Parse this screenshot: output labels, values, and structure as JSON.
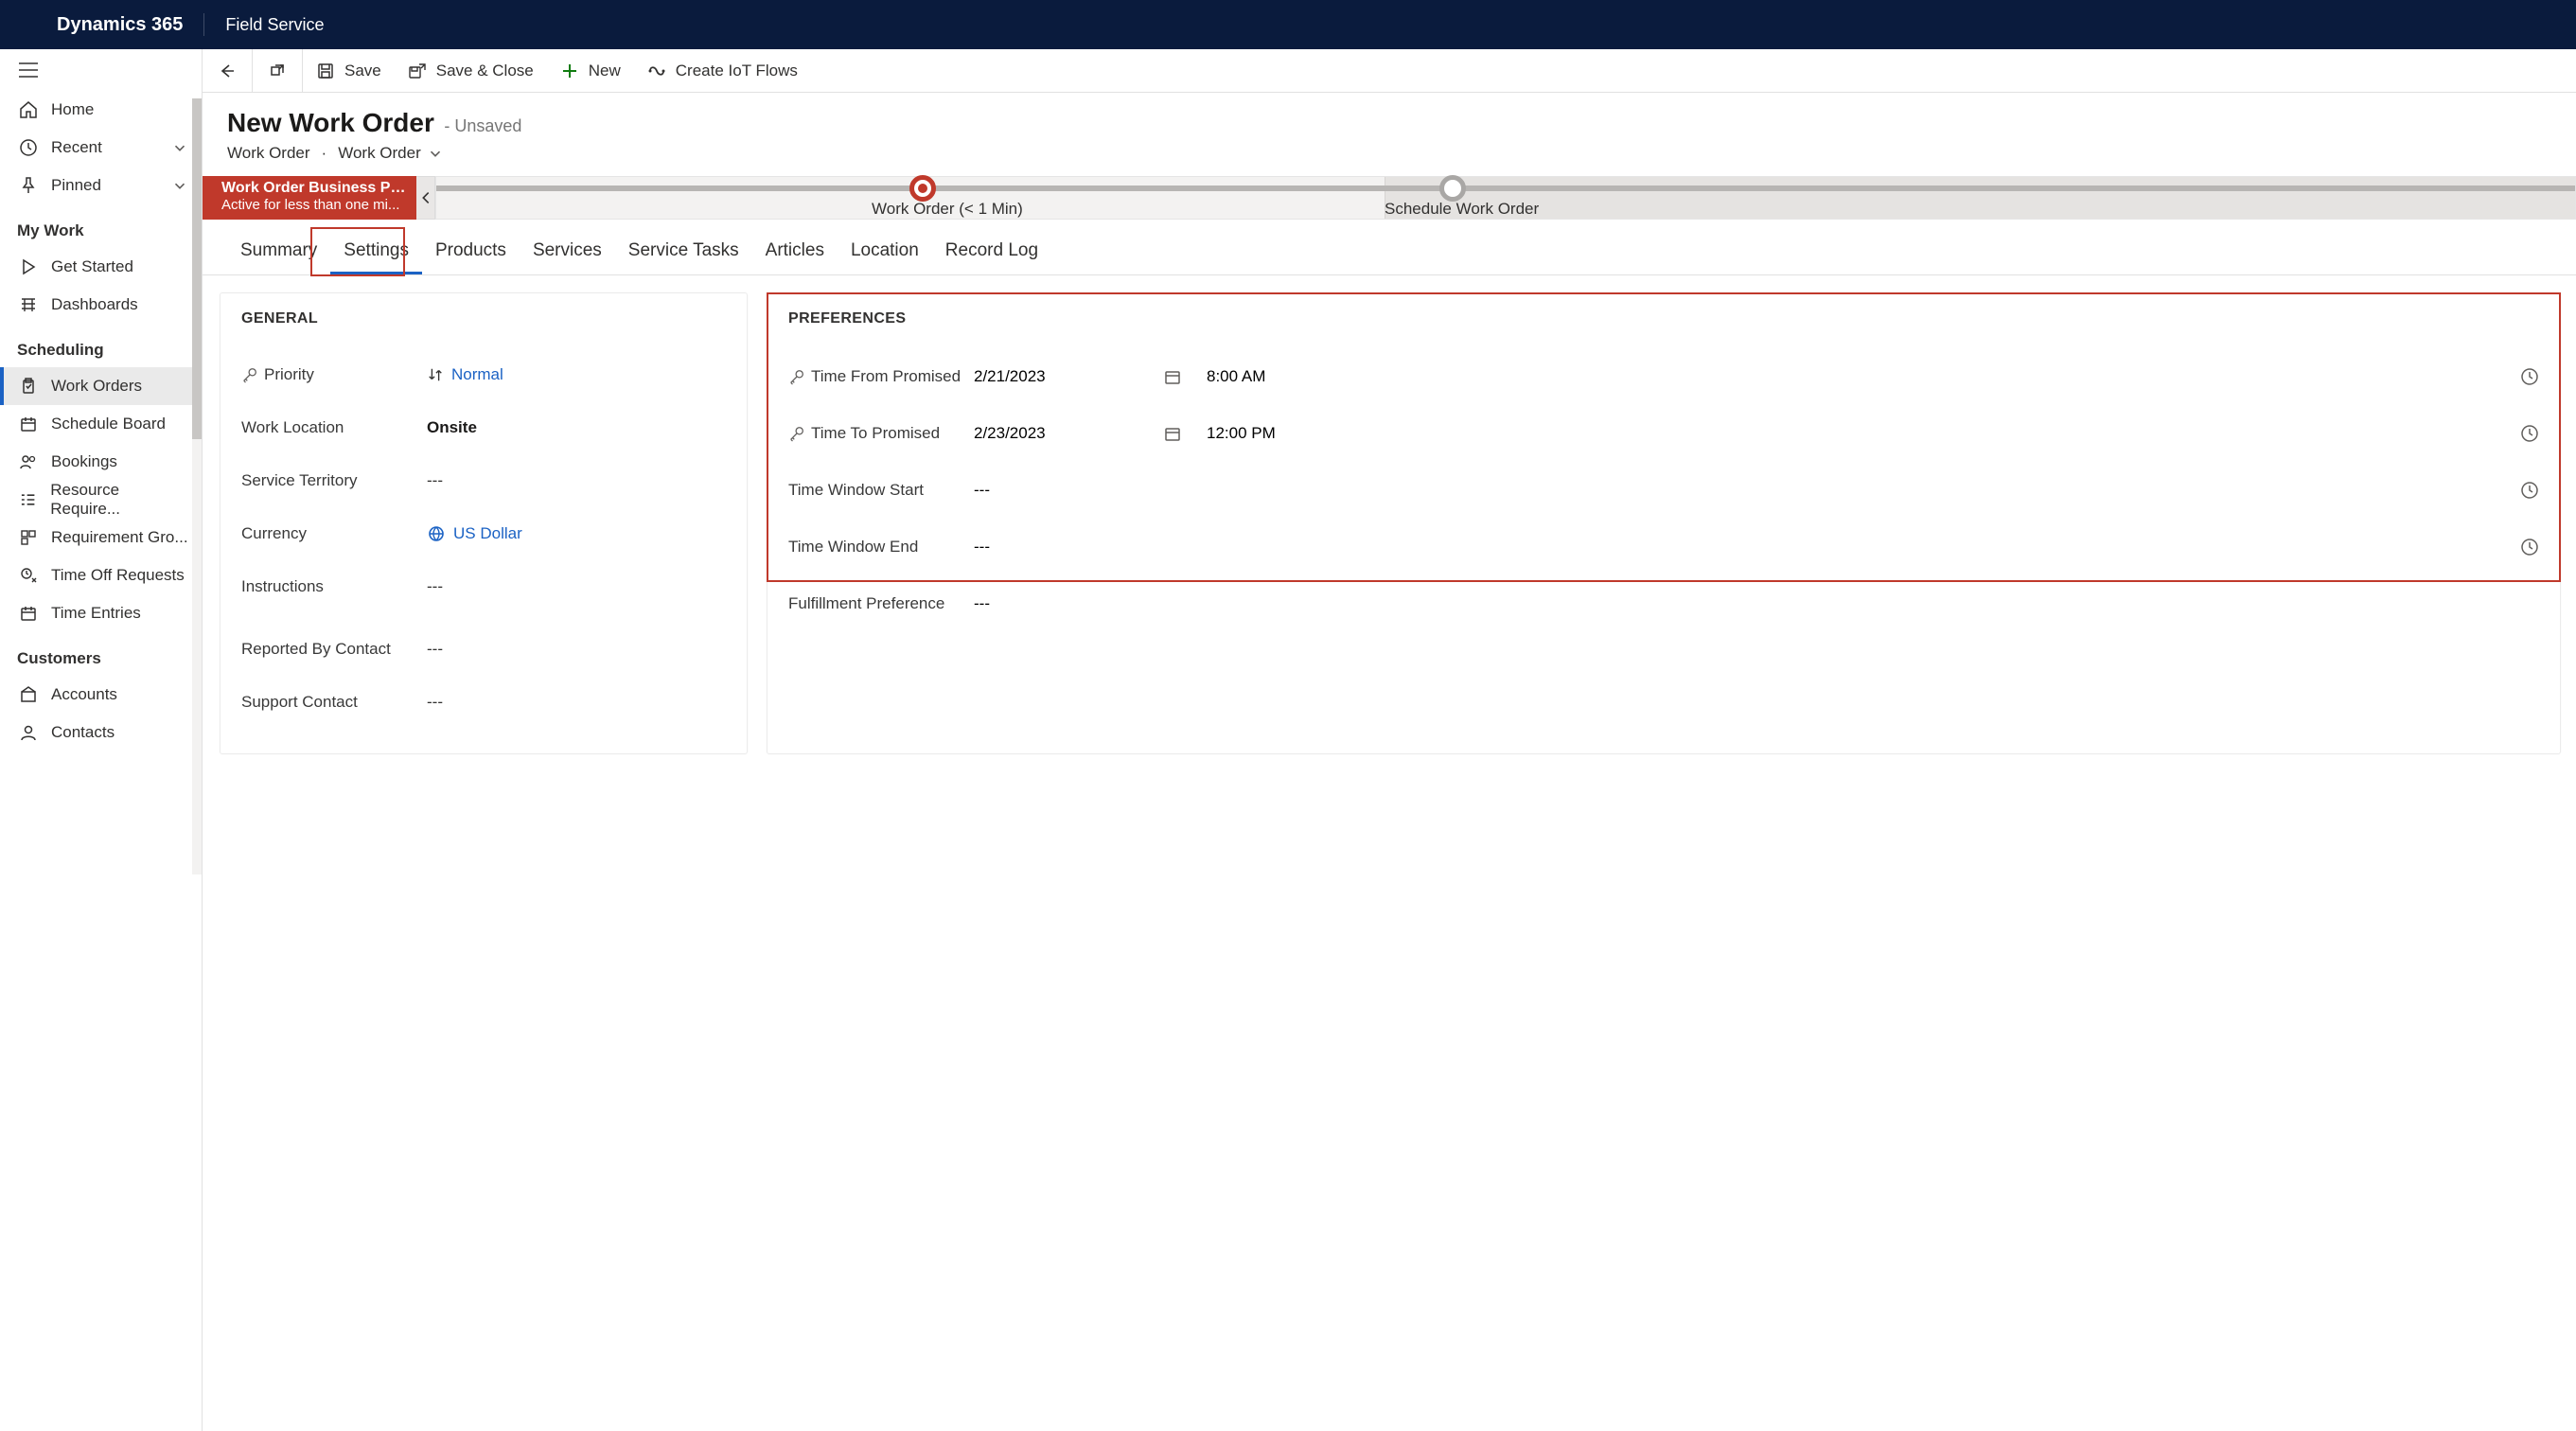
{
  "topbar": {
    "brand": "Dynamics 365",
    "area": "Field Service"
  },
  "sidebar": {
    "home": "Home",
    "recent": "Recent",
    "pinned": "Pinned",
    "sections": {
      "my_work": {
        "title": "My Work",
        "items": [
          "Get Started",
          "Dashboards"
        ]
      },
      "scheduling": {
        "title": "Scheduling",
        "items": [
          "Work Orders",
          "Schedule Board",
          "Bookings",
          "Resource Require...",
          "Requirement Gro...",
          "Time Off Requests",
          "Time Entries"
        ]
      },
      "customers": {
        "title": "Customers",
        "items": [
          "Accounts",
          "Contacts"
        ]
      }
    }
  },
  "toolbar": {
    "save": "Save",
    "save_close": "Save & Close",
    "new": "New",
    "iot": "Create IoT Flows"
  },
  "header": {
    "title": "New Work Order",
    "unsaved": "- Unsaved",
    "entity": "Work Order",
    "form": "Work Order"
  },
  "bpf": {
    "active_name": "Work Order Business Pro...",
    "active_sub": "Active for less than one mi...",
    "stage1": "Work Order  (< 1 Min)",
    "stage2": "Schedule Work Order"
  },
  "tabs": [
    "Summary",
    "Settings",
    "Products",
    "Services",
    "Service Tasks",
    "Articles",
    "Location",
    "Record Log"
  ],
  "general": {
    "title": "GENERAL",
    "fields": {
      "priority": {
        "label": "Priority",
        "value": "Normal"
      },
      "work_location": {
        "label": "Work Location",
        "value": "Onsite"
      },
      "service_territory": {
        "label": "Service Territory",
        "value": "---"
      },
      "currency": {
        "label": "Currency",
        "value": "US Dollar"
      },
      "instructions": {
        "label": "Instructions",
        "value": "---"
      },
      "reported_by": {
        "label": "Reported By Contact",
        "value": "---"
      },
      "support_contact": {
        "label": "Support Contact",
        "value": "---"
      }
    }
  },
  "prefs": {
    "title": "PREFERENCES",
    "time_from": {
      "label": "Time From Promised",
      "date": "2/21/2023",
      "time": "8:00 AM"
    },
    "time_to": {
      "label": "Time To Promised",
      "date": "2/23/2023",
      "time": "12:00 PM"
    },
    "window_start": {
      "label": "Time Window Start",
      "value": "---"
    },
    "window_end": {
      "label": "Time Window End",
      "value": "---"
    },
    "fulfillment": {
      "label": "Fulfillment Preference",
      "value": "---"
    }
  }
}
